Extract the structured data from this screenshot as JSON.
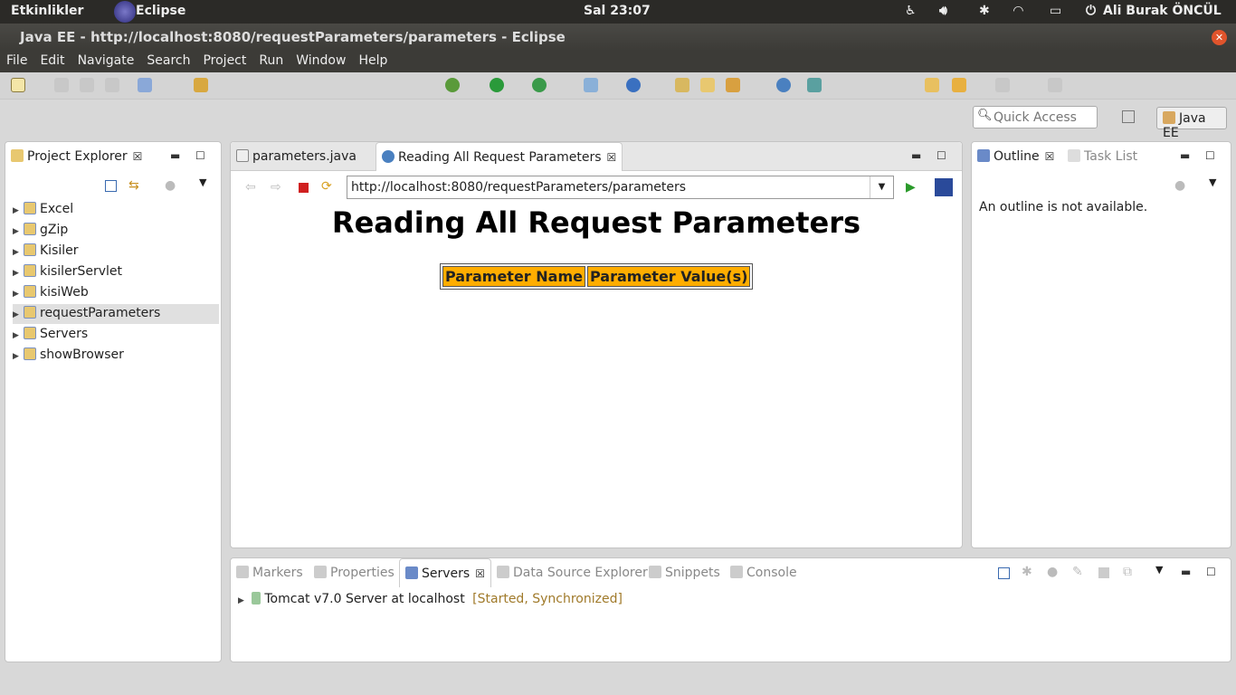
{
  "system": {
    "activities": "Etkinlikler",
    "app": "Eclipse",
    "clock": "Sal 23:07",
    "user": "Ali Burak ÖNCÜL"
  },
  "window": {
    "title": "Java EE - http://localhost:8080/requestParameters/parameters - Eclipse"
  },
  "menu": [
    "File",
    "Edit",
    "Navigate",
    "Search",
    "Project",
    "Run",
    "Window",
    "Help"
  ],
  "quick_access": {
    "placeholder": "Quick Access"
  },
  "perspective": {
    "label": "Java EE"
  },
  "project_explorer": {
    "title": "Project Explorer",
    "items": [
      {
        "label": "Excel"
      },
      {
        "label": "gZip"
      },
      {
        "label": "Kisiler"
      },
      {
        "label": "kisilerServlet"
      },
      {
        "label": "kisiWeb"
      },
      {
        "label": "requestParameters",
        "selected": true
      },
      {
        "label": "Servers"
      },
      {
        "label": "showBrowser"
      }
    ]
  },
  "editor": {
    "tabs": [
      {
        "label": "parameters.java"
      },
      {
        "label": "Reading All Request Parameters",
        "active": true
      }
    ],
    "url": "http://localhost:8080/requestParameters/parameters",
    "page": {
      "heading": "Reading All Request Parameters",
      "columns": [
        "Parameter Name",
        "Parameter Value(s)"
      ],
      "header_color": "#ffad00"
    }
  },
  "outline": {
    "tabs": [
      {
        "label": "Outline",
        "active": true
      },
      {
        "label": "Task List"
      }
    ],
    "message": "An outline is not available."
  },
  "bottom": {
    "tabs": [
      {
        "label": "Markers"
      },
      {
        "label": "Properties"
      },
      {
        "label": "Servers",
        "active": true
      },
      {
        "label": "Data Source Explorer"
      },
      {
        "label": "Snippets"
      },
      {
        "label": "Console"
      }
    ],
    "server": {
      "name": "Tomcat v7.0 Server at localhost",
      "status": "[Started, Synchronized]",
      "status_color": "#a07a2a"
    }
  }
}
